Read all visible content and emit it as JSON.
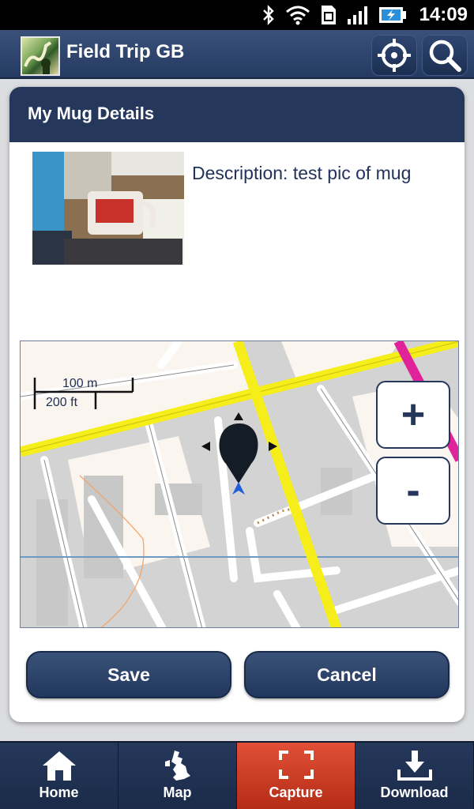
{
  "status_bar": {
    "time": "14:09",
    "icons": [
      "bluetooth-icon",
      "wifi-icon",
      "sim-icon",
      "signal-icon",
      "battery-charging-icon"
    ]
  },
  "app_bar": {
    "title": "Field Trip GB",
    "actions": [
      "locate-icon",
      "search-icon"
    ]
  },
  "dialog": {
    "title": "My Mug Details",
    "description": "Description: test pic of mug",
    "map": {
      "scale_metric": "100 m",
      "scale_imperial": "200 ft",
      "zoom_in_label": "+",
      "zoom_out_label": "-"
    },
    "save_label": "Save",
    "cancel_label": "Cancel"
  },
  "bottom_nav": {
    "items": [
      {
        "label": "Home",
        "icon": "home-icon"
      },
      {
        "label": "Map",
        "icon": "uk-map-icon"
      },
      {
        "label": "Capture",
        "icon": "capture-icon",
        "active": true
      },
      {
        "label": "Download",
        "icon": "download-icon"
      }
    ]
  },
  "colors": {
    "header_navy": "#25385b",
    "active_tab": "#d2401f",
    "road_yellow": "#f5ee1a",
    "road_magenta": "#e0239a"
  }
}
